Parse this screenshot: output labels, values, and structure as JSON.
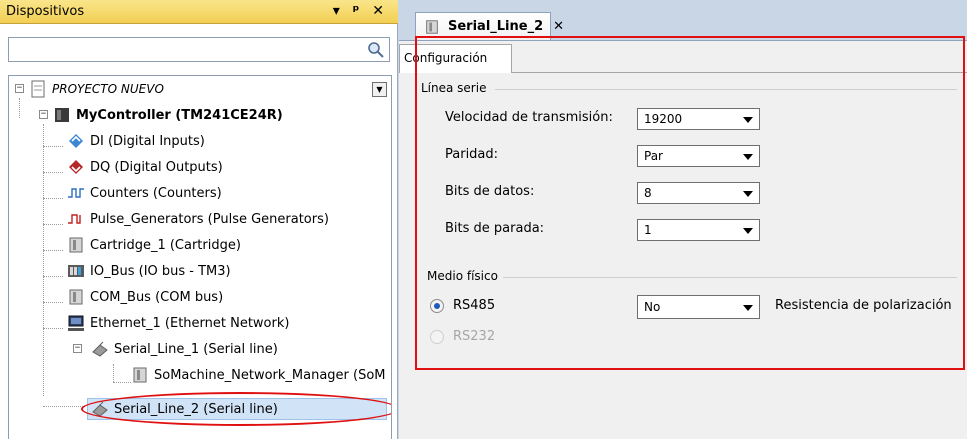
{
  "devices_panel": {
    "title": "Dispositivos",
    "controls": "▾ ⊥ ✕",
    "search": {
      "placeholder": ""
    },
    "tree": {
      "project": "PROYECTO NUEVO",
      "controller": "MyController (TM241CE24R)",
      "children": [
        "DI (Digital Inputs)",
        "DQ (Digital Outputs)",
        "Counters (Counters)",
        "Pulse_Generators (Pulse Generators)",
        "Cartridge_1 (Cartridge)",
        "IO_Bus (IO bus - TM3)",
        "COM_Bus (COM bus)",
        "Ethernet_1 (Ethernet Network)",
        "Serial_Line_1 (Serial line)",
        "SoMachine_Network_Manager (SoM",
        "Serial_Line_2 (Serial line)"
      ]
    }
  },
  "editor": {
    "tab_title": "Serial_Line_2",
    "tab_close": "✕",
    "subtab": "Configuración",
    "serial_group": {
      "label": "Línea serie",
      "fields": [
        {
          "label": "Velocidad de transmisión:",
          "value": "19200"
        },
        {
          "label": "Paridad:",
          "value": "Par"
        },
        {
          "label": "Bits de datos:",
          "value": "8"
        },
        {
          "label": "Bits de parada:",
          "value": "1"
        }
      ]
    },
    "physical_group": {
      "label": "Medio físico",
      "rs485": "RS485",
      "rs232": "RS232",
      "polarization_value": "No",
      "polarization_label": "Resistencia de polarización"
    }
  },
  "colors": {
    "title_bar": "#f3cf53",
    "highlight": "#e01010",
    "selection": "#d1e3f7"
  }
}
